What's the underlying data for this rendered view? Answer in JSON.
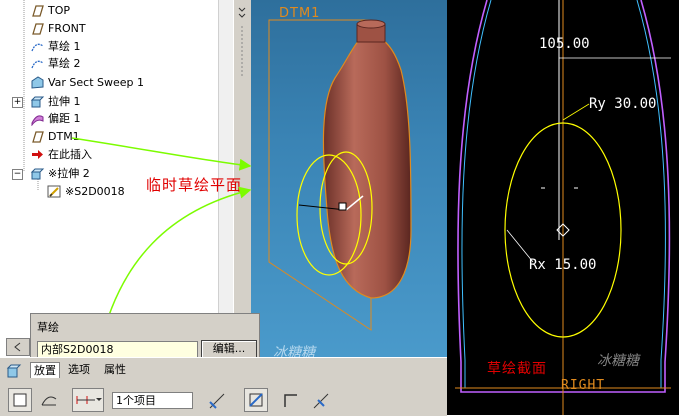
{
  "tree": {
    "items": [
      {
        "label": "TOP"
      },
      {
        "label": "FRONT"
      },
      {
        "label": "草绘 1"
      },
      {
        "label": "草绘 2"
      },
      {
        "label": "Var Sect Sweep 1"
      },
      {
        "label": "拉伸 1"
      },
      {
        "label": "偏距 1"
      },
      {
        "label": "DTM1"
      },
      {
        "label": "在此插入"
      },
      {
        "label": "※拉伸 2"
      },
      {
        "label": "※S2D0018"
      }
    ]
  },
  "viewport": {
    "datum_label": "DTM1",
    "annotation": "临时草绘平面",
    "watermark": "冰糖糖"
  },
  "sketch_panel": {
    "title": "草绘",
    "section_value": "内部S2D0018",
    "edit_button": "编辑..."
  },
  "dashboard": {
    "tabs": [
      "放置",
      "选项",
      "属性"
    ],
    "item_count": "1个项目"
  },
  "sketch_view": {
    "dim_top": "105.00",
    "dim_ry": "Ry 30.00",
    "dim_rx": "Rx 15.00",
    "label_section": "草绘截面",
    "label_right": "RIGHT",
    "watermark": "冰糖糖"
  },
  "colors": {
    "annotation_red": "#e00000",
    "arrow_green": "#7cfc00",
    "sketch_yellow": "#ffff00",
    "profile_purple": "#c060ff",
    "profile_cyan": "#40c0ff",
    "datum_orange": "#e08a1e",
    "body_brown": "#a85c4e"
  }
}
